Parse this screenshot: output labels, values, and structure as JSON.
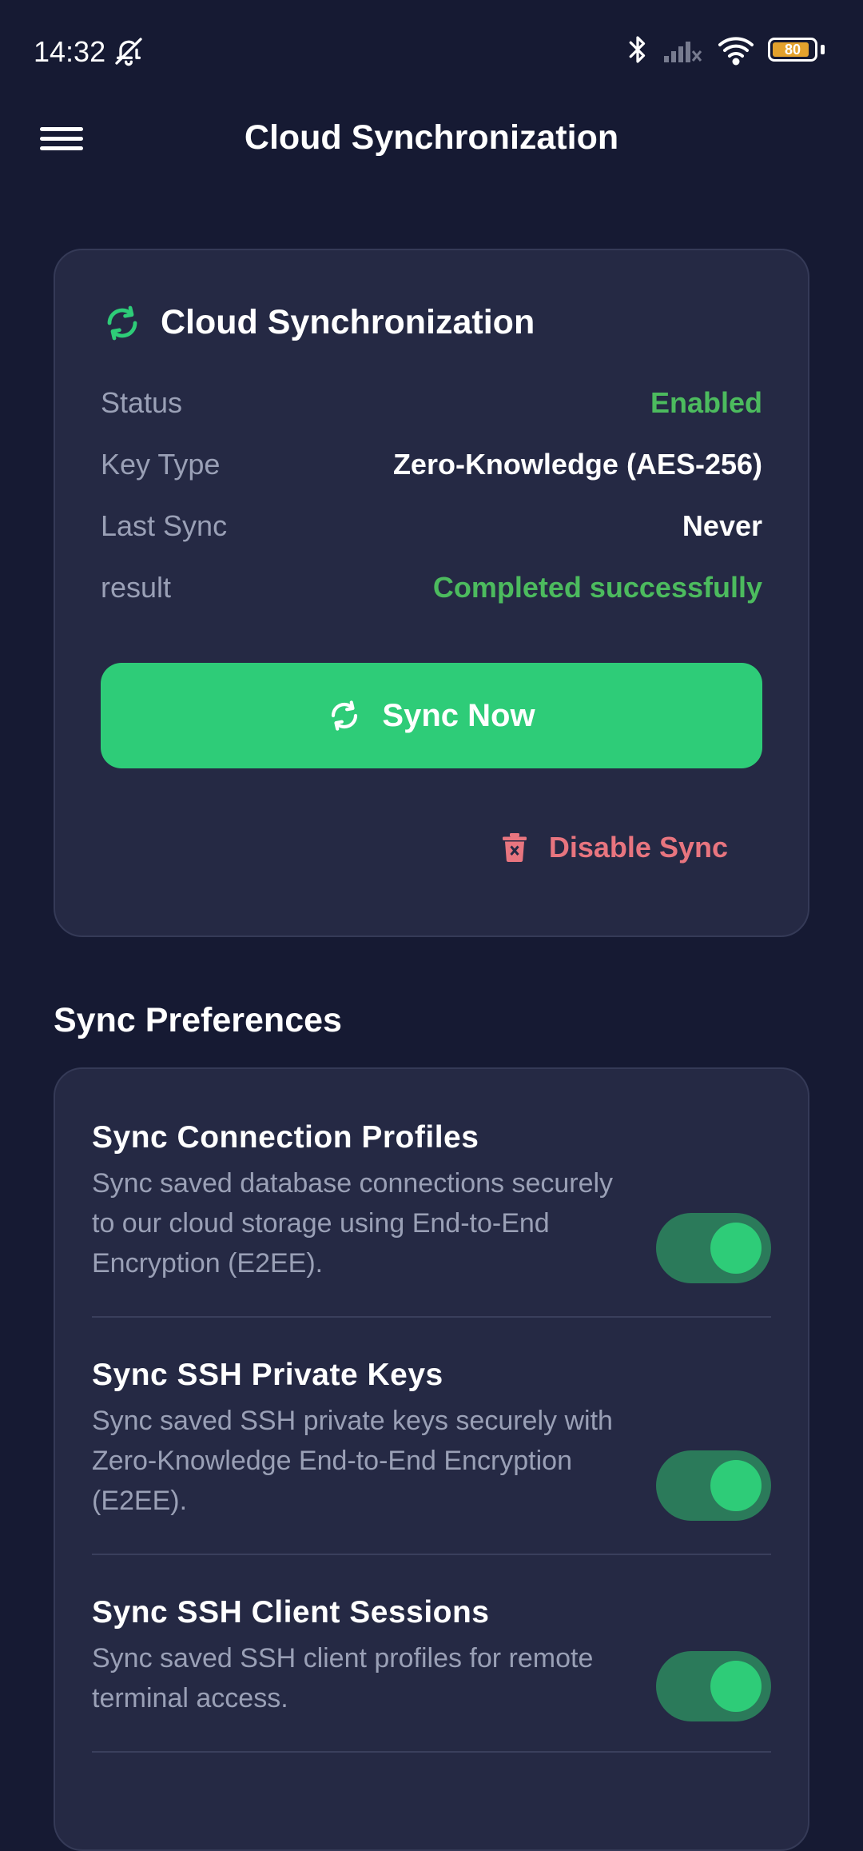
{
  "status_bar": {
    "time": "14:32",
    "battery_level": "80",
    "icons": [
      "bell-off-icon",
      "bluetooth-icon",
      "signal-off-icon",
      "wifi-icon",
      "battery-icon"
    ]
  },
  "app_bar": {
    "title": "Cloud Synchronization",
    "menu_icon": "hamburger-menu-icon"
  },
  "sync_card": {
    "title": "Cloud Synchronization",
    "icon": "sync-icon",
    "rows": [
      {
        "key": "Status",
        "value": "Enabled"
      },
      {
        "key": "Key Type",
        "value": "Zero-Knowledge (AES-256)"
      },
      {
        "key": "Last Sync",
        "value": "Never"
      },
      {
        "key": "result",
        "value": "Completed successfully"
      }
    ],
    "sync_button_label": "Sync Now",
    "disable_button_label": "Disable Sync"
  },
  "preferences": {
    "section_title": "Sync Preferences",
    "items": [
      {
        "title": "Sync Connection Profiles",
        "description": "Sync saved database connections securely to our cloud storage using End-to-End Encryption (E2EE).",
        "enabled": true
      },
      {
        "title": "Sync SSH Private Keys",
        "description": "Sync saved SSH private keys securely with Zero-Knowledge End-to-End Encryption (E2EE).",
        "enabled": true
      },
      {
        "title": "Sync SSH Client Sessions",
        "description": "Sync saved SSH client profiles for remote terminal access.",
        "enabled": true
      }
    ]
  },
  "colors": {
    "background": "#161a33",
    "card": "#252944",
    "accent_green": "#2ecc78",
    "status_green": "#4cbb5e",
    "danger": "#e8757f",
    "muted_text": "#9aa0b6",
    "toggle_track": "#2b7a5a"
  }
}
